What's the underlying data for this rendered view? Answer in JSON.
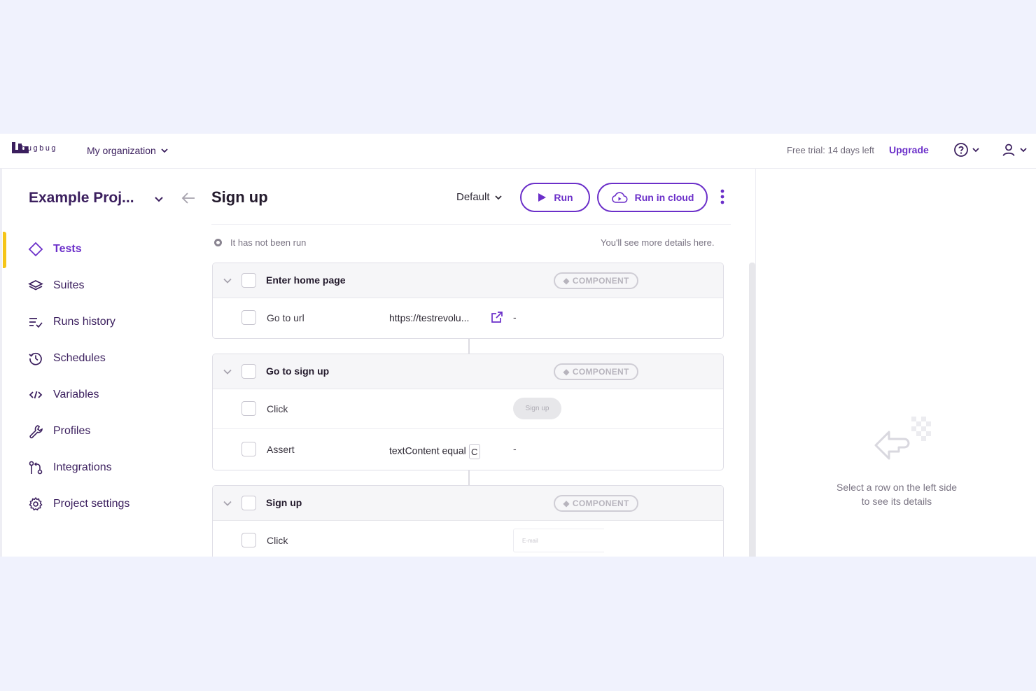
{
  "brand": {
    "name": "bugbug",
    "accent": "#6b2fc9",
    "highlight": "#f5c518"
  },
  "topbar": {
    "org_label": "My organization",
    "trial_text": "Free trial: 14 days left",
    "upgrade_label": "Upgrade",
    "help_icon": "help-circle-icon",
    "user_icon": "user-icon"
  },
  "sidebar": {
    "project_name": "Example Proj...",
    "items": [
      {
        "label": "Tests",
        "icon": "diamond-icon",
        "active": true
      },
      {
        "label": "Suites",
        "icon": "layers-icon",
        "active": false
      },
      {
        "label": "Runs history",
        "icon": "list-check-icon",
        "active": false
      },
      {
        "label": "Schedules",
        "icon": "history-clock-icon",
        "active": false
      },
      {
        "label": "Variables",
        "icon": "code-icon",
        "active": false
      },
      {
        "label": "Profiles",
        "icon": "wrench-icon",
        "active": false
      },
      {
        "label": "Integrations",
        "icon": "git-merge-icon",
        "active": false
      },
      {
        "label": "Project settings",
        "icon": "gear-icon",
        "active": false
      }
    ]
  },
  "main": {
    "title": "Sign up",
    "environment": "Default",
    "run_label": "Run",
    "run_cloud_label": "Run in cloud",
    "status_text": "It has not been run",
    "details_hint": "You'll see more details here.",
    "component_badge": "COMPONENT",
    "groups": [
      {
        "name": "Enter home page",
        "steps": [
          {
            "action": "Go to url",
            "value": "https://testrevolu...",
            "suffix": "-"
          }
        ]
      },
      {
        "name": "Go to sign up",
        "steps": [
          {
            "action": "Click",
            "preview": "Sign up"
          },
          {
            "action": "Assert",
            "value": "textContent equal",
            "boxed": "C",
            "suffix": "-"
          }
        ]
      },
      {
        "name": "Sign up",
        "steps": [
          {
            "action": "Click",
            "preview": "E-mail"
          }
        ]
      }
    ]
  },
  "details_panel": {
    "line1": "Select a row on the left side",
    "line2": "to see its details"
  }
}
